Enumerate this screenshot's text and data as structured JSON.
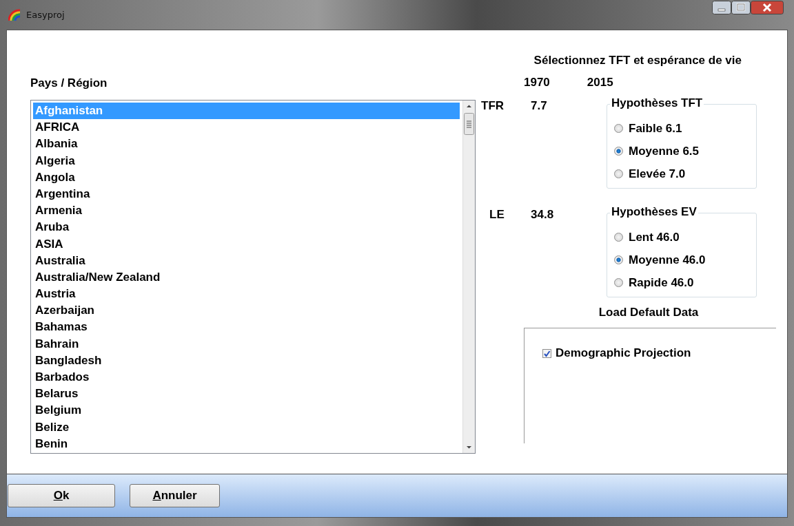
{
  "window": {
    "title": "Easyproj"
  },
  "heading": "Sélectionnez TFT et espérance de vie",
  "country_list": {
    "label": "Pays / Région",
    "items": [
      {
        "text": "Afghanistan",
        "selected": true
      },
      {
        "text": "AFRICA",
        "selected": false
      },
      {
        "text": "Albania",
        "selected": false
      },
      {
        "text": "Algeria",
        "selected": false
      },
      {
        "text": "Angola",
        "selected": false
      },
      {
        "text": "Argentina",
        "selected": false
      },
      {
        "text": "Armenia",
        "selected": false
      },
      {
        "text": "Aruba",
        "selected": false
      },
      {
        "text": "ASIA",
        "selected": false
      },
      {
        "text": "Australia",
        "selected": false
      },
      {
        "text": "Australia/New Zealand",
        "selected": false
      },
      {
        "text": "Austria",
        "selected": false
      },
      {
        "text": "Azerbaijan",
        "selected": false
      },
      {
        "text": "Bahamas",
        "selected": false
      },
      {
        "text": "Bahrain",
        "selected": false
      },
      {
        "text": "Bangladesh",
        "selected": false
      },
      {
        "text": "Barbados",
        "selected": false
      },
      {
        "text": "Belarus",
        "selected": false
      },
      {
        "text": "Belgium",
        "selected": false
      },
      {
        "text": "Belize",
        "selected": false
      },
      {
        "text": "Benin",
        "selected": false
      }
    ]
  },
  "years": [
    "1970",
    "2015"
  ],
  "indicators": [
    {
      "label": "TFR",
      "value": "7.7",
      "group": {
        "title": "Hypothèses TFT",
        "options": [
          {
            "text": "Faible 6.1",
            "selected": false
          },
          {
            "text": "Moyenne 6.5",
            "selected": true
          },
          {
            "text": "Elevée 7.0",
            "selected": false
          }
        ]
      }
    },
    {
      "label": "LE",
      "value": "34.8",
      "group": {
        "title": "Hypothèses EV",
        "options": [
          {
            "text": "Lent 46.0",
            "selected": false
          },
          {
            "text": "Moyenne 46.0",
            "selected": true
          },
          {
            "text": "Rapide 46.0",
            "selected": false
          }
        ]
      }
    }
  ],
  "load_default": {
    "title": "Load Default Data",
    "checkbox": {
      "label": "Demographic Projection",
      "checked": true
    }
  },
  "buttons": [
    "Ok",
    "Annuler"
  ]
}
